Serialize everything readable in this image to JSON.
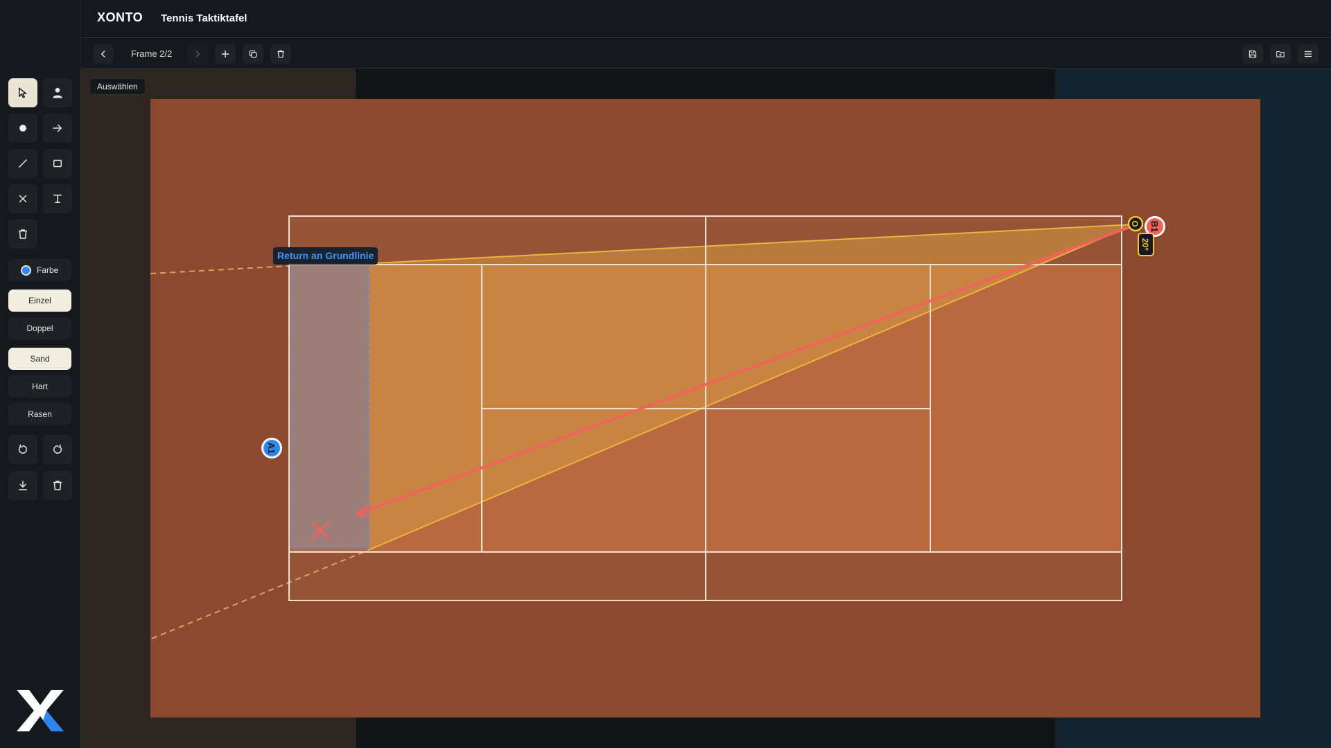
{
  "header": {
    "logo": "XONTO",
    "title": "Tennis Taktiktafel"
  },
  "toolbar": {
    "frame_label": "Frame 2/2"
  },
  "sidebar": {
    "tools": [
      {
        "name": "select",
        "icon": "cursor-icon"
      },
      {
        "name": "player",
        "icon": "person-icon"
      },
      {
        "name": "ball",
        "icon": "circle-icon"
      },
      {
        "name": "arrow",
        "icon": "arrow-right-icon"
      },
      {
        "name": "line",
        "icon": "line-icon"
      },
      {
        "name": "rectangle",
        "icon": "rectangle-icon"
      },
      {
        "name": "cross",
        "icon": "x-mark-icon"
      },
      {
        "name": "text",
        "icon": "text-icon"
      },
      {
        "name": "delete",
        "icon": "trash-icon"
      }
    ],
    "color_label": "Farbe",
    "color_value": "#2f86ef",
    "match_modes": [
      "Einzel",
      "Doppel"
    ],
    "surfaces": [
      "Sand",
      "Hart",
      "Rasen"
    ],
    "active_mode": "Einzel",
    "active_surface": "Sand"
  },
  "canvas": {
    "mode_hint": "Auswählen",
    "zone_label": "Return an Grundlinie",
    "player_a": "A1",
    "player_b": "B1",
    "ball_label": "O",
    "angle_label": "20°"
  },
  "colors": {
    "accent": "#2f86ef",
    "clay": "#8b4a2f",
    "court": "#b86a42",
    "lines": "#f3e1d0",
    "cone": "#f2b23c",
    "shot": "#f0625a"
  }
}
